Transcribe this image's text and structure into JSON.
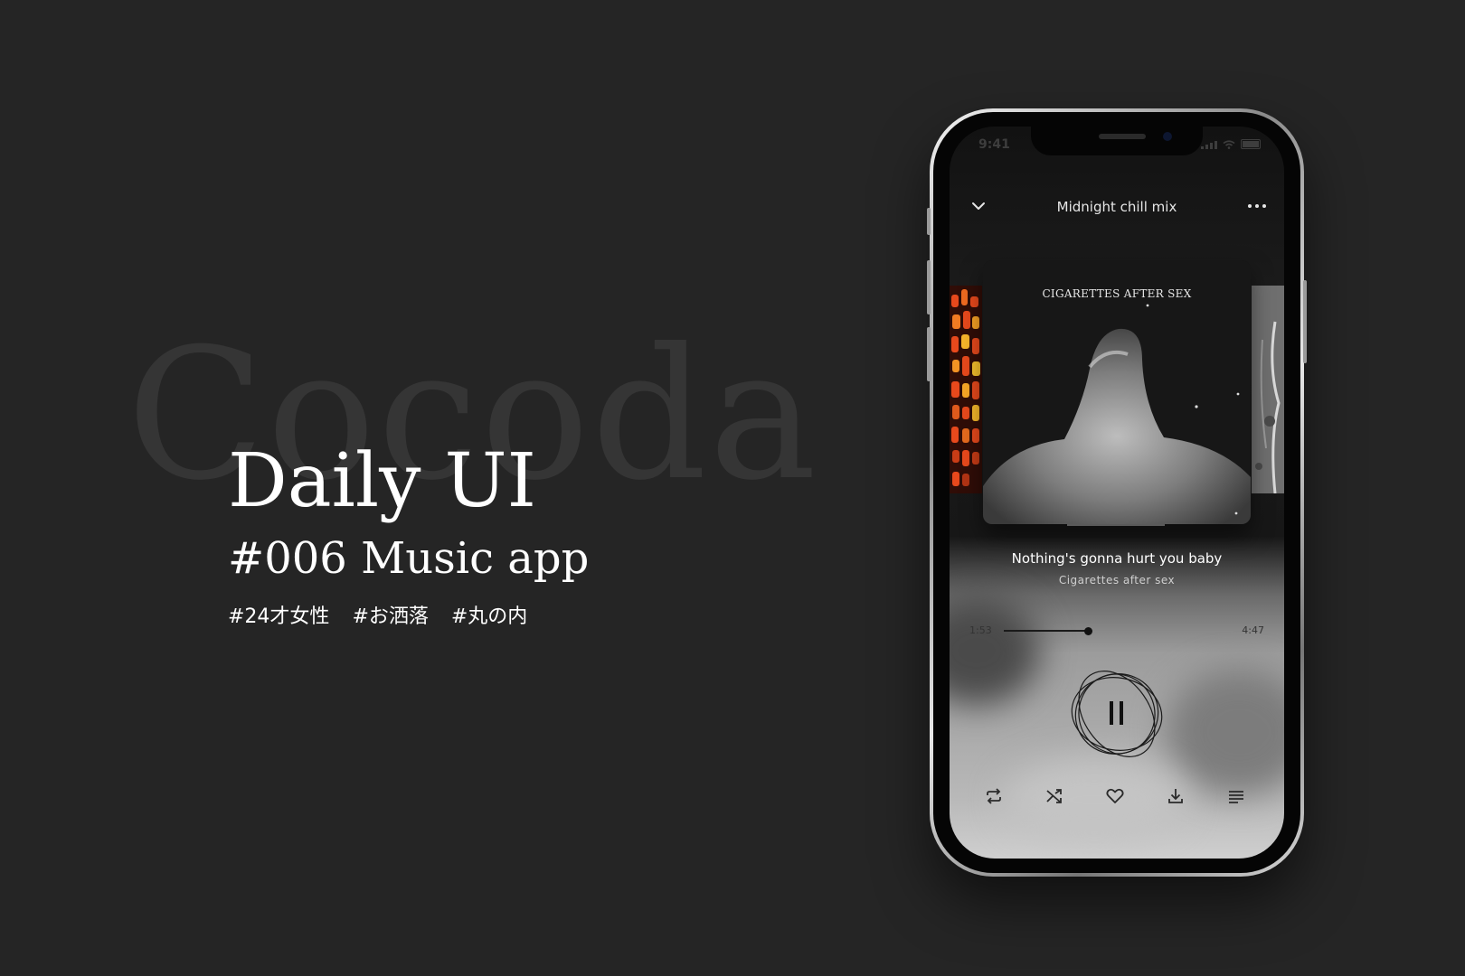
{
  "hero": {
    "background_word": "Cocoda",
    "title": "Daily UI",
    "subtitle": "#006 Music app",
    "tags": [
      "#24才女性",
      "#お洒落",
      "#丸の内"
    ]
  },
  "status_bar": {
    "time": "9:41"
  },
  "player": {
    "playlist_title": "Midnight chill mix",
    "album_cover_text": "CIGARETTES AFTER SEX",
    "song_title": "Nothing's gonna hurt you baby",
    "artist": "Cigarettes after sex",
    "current_time": "1:53",
    "total_time": "4:47",
    "progress_fraction": 0.365,
    "state": "playing"
  },
  "icons": {
    "collapse": "chevron-down-icon",
    "more": "more-dots-icon",
    "play_pause": "pause-icon",
    "repeat": "repeat-icon",
    "shuffle": "shuffle-icon",
    "like": "heart-icon",
    "download": "download-icon",
    "queue": "queue-list-icon"
  },
  "colors": {
    "page_background": "#252525",
    "text_primary": "#ffffff",
    "watermark": "#353535"
  }
}
